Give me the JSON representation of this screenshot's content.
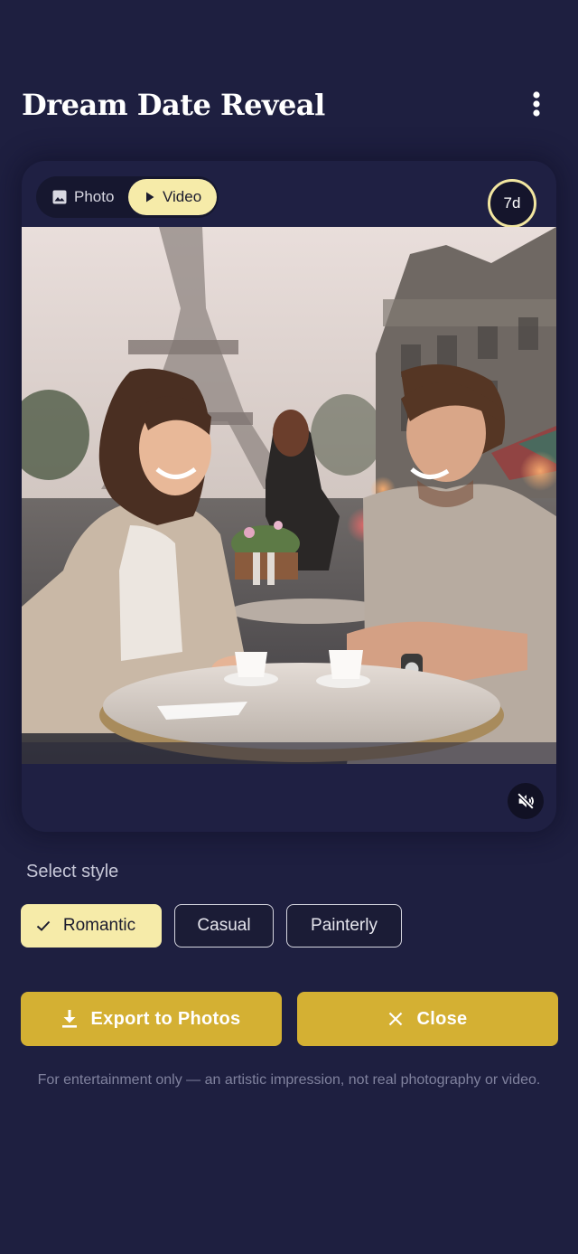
{
  "header": {
    "title": "Dream Date Reveal",
    "menu_icon": "more-vertical-icon"
  },
  "media_toggle": {
    "options": [
      {
        "label": "Photo",
        "icon": "image-icon",
        "selected": false
      },
      {
        "label": "Video",
        "icon": "play-icon",
        "selected": true
      }
    ]
  },
  "timer_badge": "7d",
  "media": {
    "mute_icon": "volume-muted-icon"
  },
  "styles": {
    "label": "Select style",
    "options": [
      {
        "label": "Romantic",
        "selected": true,
        "icon": "check-icon"
      },
      {
        "label": "Casual",
        "selected": false
      },
      {
        "label": "Painterly",
        "selected": false
      }
    ]
  },
  "actions": {
    "export": {
      "label": "Export to Photos",
      "icon": "download-icon"
    },
    "close": {
      "label": "Close",
      "icon": "close-icon"
    }
  },
  "disclaimer": "For entertainment only — an artistic impression, not real photography or video.",
  "colors": {
    "background": "#1e1f40",
    "accent_light": "#f6eba9",
    "accent_gold": "#d4b033"
  }
}
